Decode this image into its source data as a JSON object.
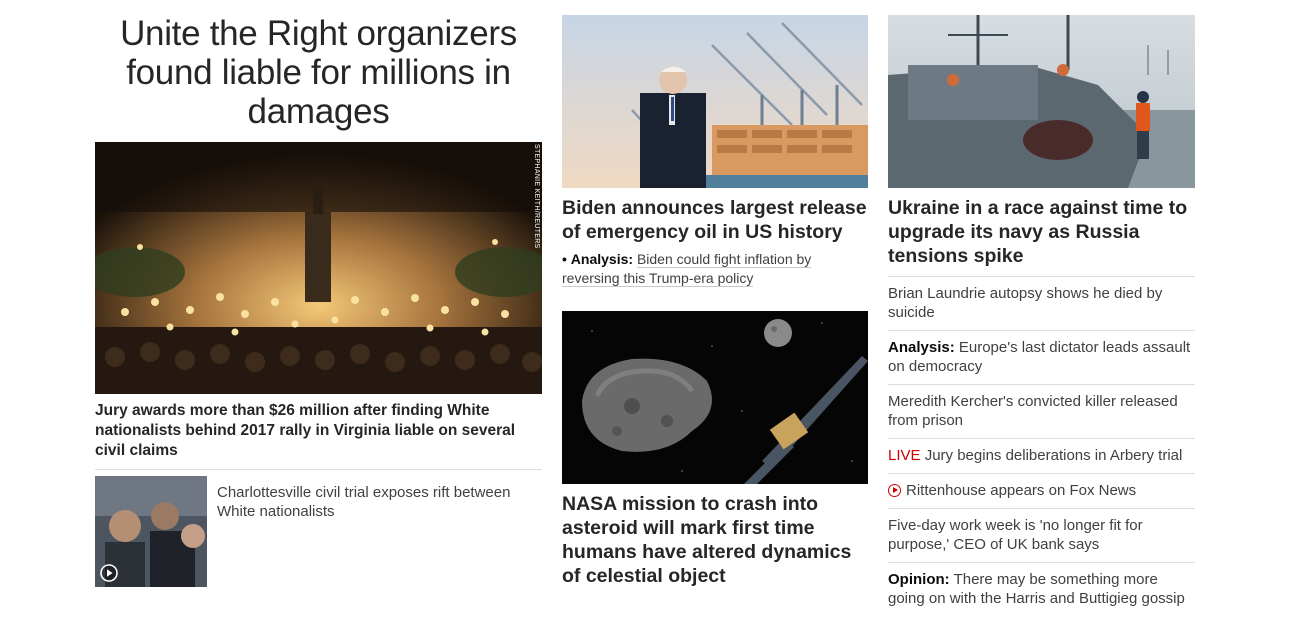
{
  "lead": {
    "headline": "Unite the Right organizers found liable for millions in damages",
    "image_credit": "STEPHANIE KEITH/REUTERS",
    "caption": "Jury awards more than $26 million after finding White nationalists behind 2017 rally in Virginia liable on several civil claims",
    "related": {
      "text": "Charlottesville civil trial exposes rift between White nationalists",
      "icon": "play-circle-icon"
    }
  },
  "middle": {
    "story1": {
      "headline": "Biden announces largest release of emergency oil in US history",
      "analysis_bullet": "•",
      "analysis_label": "Analysis:",
      "analysis_text": "Biden could fight inflation by reversing this Trump-era policy"
    },
    "story2": {
      "headline": "NASA mission to crash into asteroid will mark first time humans have altered dynamics of celestial object"
    }
  },
  "right": {
    "headline": "Ukraine in a race against time to upgrade its navy as Russia tensions spike",
    "items": [
      {
        "label": "",
        "text": "Brian Laundrie autopsy shows he died by suicide"
      },
      {
        "label": "Analysis:",
        "text": "Europe's last dictator leads assault on democracy"
      },
      {
        "label": "",
        "text": "Meredith Kercher's convicted killer released from prison"
      },
      {
        "label": "LIVE",
        "text": "Jury begins deliberations in Arbery trial"
      },
      {
        "label": "",
        "text": "Rittenhouse appears on Fox News",
        "icon": "play-circle-icon"
      },
      {
        "label": "",
        "text": "Five-day work week is 'no longer fit for purpose,' CEO of UK bank says"
      },
      {
        "label": "Opinion:",
        "text": "There may be something more going on with the Harris and Buttigieg gossip"
      }
    ]
  },
  "colors": {
    "live_red": "#cc0000",
    "headline_text": "#262626",
    "body_text": "#404040",
    "divider": "#dedede"
  }
}
